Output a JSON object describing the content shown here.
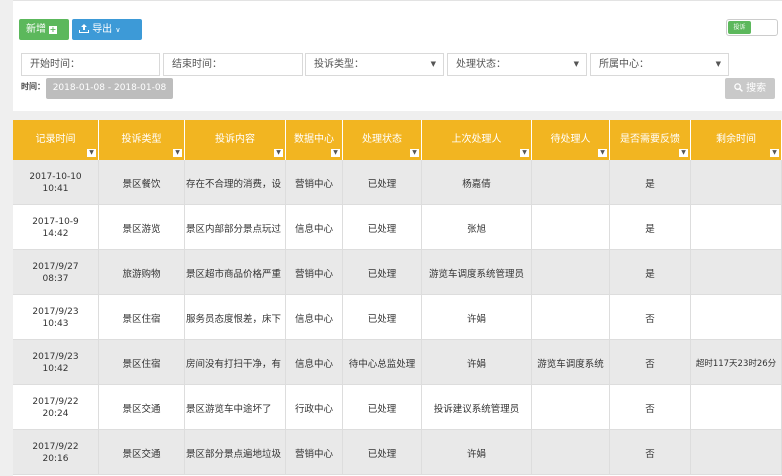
{
  "toolbar": {
    "add_label": "新增",
    "add_icon": "plus-icon",
    "export_label": "导出",
    "export_icon": "upload-icon"
  },
  "toggle": {
    "label": "投诉"
  },
  "filters": {
    "start_time": "开始时间：",
    "end_time": "结束时间：",
    "complaint_type": "投诉类型：",
    "status": "处理状态：",
    "center": "所属中心："
  },
  "time_label": "时间：",
  "date_range": "2018-01-08 - 2018-01-08",
  "search_label": "搜索",
  "table": {
    "columns": [
      "记录时间",
      "投诉类型",
      "投诉内容",
      "数据中心",
      "处理状态",
      "上次处理人",
      "待处理人",
      "是否需要反馈",
      "剩余时间"
    ],
    "rows": [
      {
        "time1": "2017-10-10",
        "time2": "10:41",
        "type": "景区餐饮",
        "content": "存在不合理的消费，设",
        "center": "营销中心",
        "status": "已处理",
        "last": "杨嘉倩",
        "pending": "",
        "feedback": "是",
        "remain": ""
      },
      {
        "time1": "2017-10-9",
        "time2": "14:42",
        "type": "景区游览",
        "content": "景区内部部分景点玩过",
        "center": "信息中心",
        "status": "已处理",
        "last": "张旭",
        "pending": "",
        "feedback": "是",
        "remain": ""
      },
      {
        "time1": "2017/9/27",
        "time2": "08:37",
        "type": "旅游购物",
        "content": "景区超市商品价格严重",
        "center": "营销中心",
        "status": "已处理",
        "last": "游览车调度系统管理员",
        "pending": "",
        "feedback": "是",
        "remain": ""
      },
      {
        "time1": "2017/9/23",
        "time2": "10:43",
        "type": "景区住宿",
        "content": "服务员态度恨差，床下",
        "center": "信息中心",
        "status": "已处理",
        "last": "许娟",
        "pending": "",
        "feedback": "否",
        "remain": ""
      },
      {
        "time1": "2017/9/23",
        "time2": "10:42",
        "type": "景区住宿",
        "content": "房间没有打扫干净，有",
        "center": "信息中心",
        "status": "待中心总监处理",
        "last": "许娟",
        "pending": "游览车调度系统",
        "feedback": "否",
        "remain": "超时117天23时26分"
      },
      {
        "time1": "2017/9/22",
        "time2": "20:24",
        "type": "景区交通",
        "content": "景区游览车中途坏了",
        "center": "行政中心",
        "status": "已处理",
        "last": "投诉建议系统管理员",
        "pending": "",
        "feedback": "否",
        "remain": ""
      },
      {
        "time1": "2017/9/22",
        "time2": "20:16",
        "type": "景区交通",
        "content": "景区部分景点遍地垃圾",
        "center": "营销中心",
        "status": "已处理",
        "last": "许娟",
        "pending": "",
        "feedback": "否",
        "remain": ""
      }
    ]
  }
}
